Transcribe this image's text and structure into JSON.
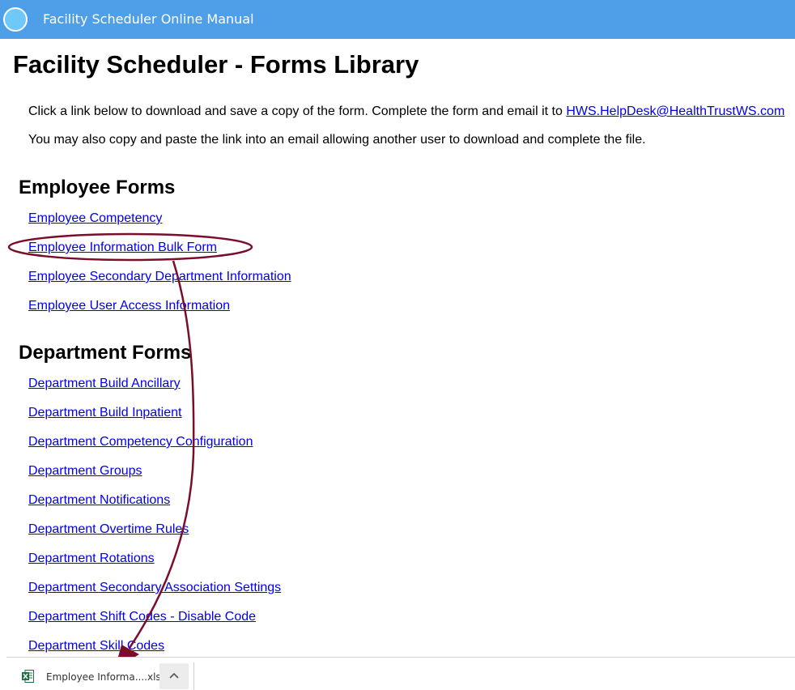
{
  "header": {
    "title": "Facility Scheduler Online Manual",
    "logo_icon": "circle-logo-icon"
  },
  "page": {
    "title": "Facility Scheduler - Forms Library",
    "intro_text": "Click a link below to download and save a copy of the form. Complete the form and email it to ",
    "intro_email": "HWS.HelpDesk@HealthTrustWS.com",
    "intro_text2": "You may also copy and paste the link into an email allowing another user to download and complete the file."
  },
  "employee_forms": {
    "heading": "Employee Forms",
    "links": [
      "Employee Competency",
      "Employee Information Bulk Form",
      "Employee Secondary Department Information",
      "Employee User Access Information"
    ]
  },
  "department_forms": {
    "heading": "Department Forms",
    "links": [
      "Department Build Ancillary",
      "Department Build Inpatient",
      "Department Competency Configuration",
      "Department Groups",
      "Department Notifications",
      "Department Overtime Rules",
      "Department Rotations",
      "Department Secondary Association Settings",
      "Department Shift Codes - Disable Code",
      "Department Skill Codes"
    ]
  },
  "download_bar": {
    "file_name": "Employee Informa....xlsx",
    "file_icon": "excel-file-icon",
    "menu_icon": "chevron-up-icon"
  },
  "colors": {
    "header": "#4f9ee8",
    "link": "#0000ee",
    "annotation": "#7a0d2a"
  }
}
